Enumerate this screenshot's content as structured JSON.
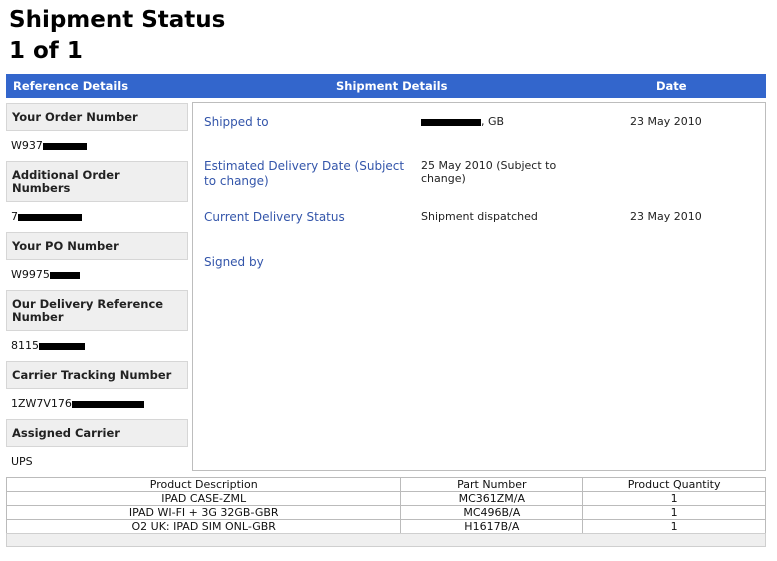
{
  "page": {
    "title": "Shipment Status",
    "pager": "1 of 1"
  },
  "header": {
    "reference_details": "Reference Details",
    "shipment_details": "Shipment Details",
    "date": "Date"
  },
  "colors": {
    "header_bar": "#3366cc",
    "label_bg": "#efefef",
    "link_blue": "#3355aa"
  },
  "reference": [
    {
      "label": "Your Order Number",
      "value_visible": "W937"
    },
    {
      "label": "Additional Order Numbers",
      "value_visible": "7"
    },
    {
      "label": "Your PO Number",
      "value_visible": "W9975"
    },
    {
      "label": "Our Delivery Reference Number",
      "value_visible": "8115"
    },
    {
      "label": "Carrier Tracking Number",
      "value_visible": "1ZW7V176"
    },
    {
      "label": "Assigned Carrier",
      "value_visible": "UPS"
    }
  ],
  "shipment": [
    {
      "label": "Shipped to",
      "value": ", GB",
      "date": "23 May 2010"
    },
    {
      "label": "Estimated Delivery Date (Subject to change)",
      "value": "25 May 2010 (Subject to change)",
      "date": ""
    },
    {
      "label": "Current Delivery Status",
      "value": "Shipment dispatched",
      "date": "23 May 2010"
    },
    {
      "label": "Signed by",
      "value": "",
      "date": ""
    }
  ],
  "products": {
    "headers": [
      "Product Description",
      "Part Number",
      "Product Quantity"
    ],
    "rows": [
      [
        "IPAD CASE-ZML",
        "MC361ZM/A",
        "1"
      ],
      [
        "IPAD WI-FI + 3G 32GB-GBR",
        "MC496B/A",
        "1"
      ],
      [
        "O2 UK: IPAD SIM ONL-GBR",
        "H1617B/A",
        "1"
      ]
    ]
  }
}
